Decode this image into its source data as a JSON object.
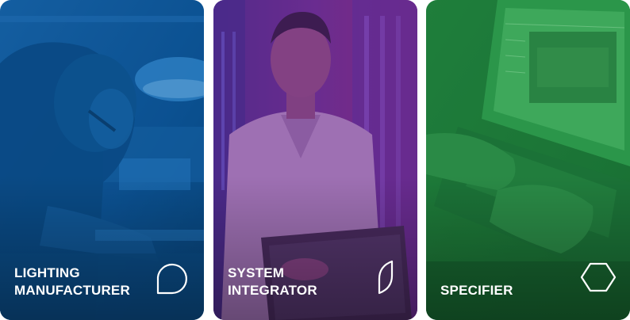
{
  "cards": [
    {
      "label_line1": "LIGHTING",
      "label_line2": "MANUFACTURER",
      "icon": "rounded-teardrop-icon",
      "tint": "#0a5fa6"
    },
    {
      "label_line1": "SYSTEM",
      "label_line2": "INTEGRATOR",
      "icon": "leaf-blade-icon",
      "tint": "#6a2a8c"
    },
    {
      "label_line1": "SPECIFIER",
      "label_line2": "",
      "icon": "hexagon-icon",
      "tint": "#1f8a3f"
    }
  ]
}
